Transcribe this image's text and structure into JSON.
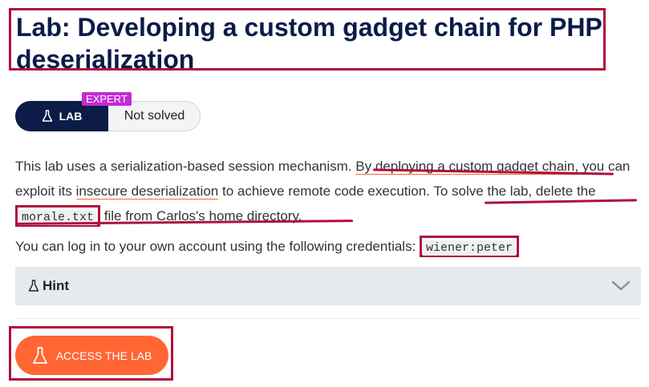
{
  "header": {
    "title": "Lab: Developing a custom gadget chain for PHP deserialization"
  },
  "badge": {
    "level": "EXPERT",
    "lab_label": "LAB",
    "status": "Not solved"
  },
  "description": {
    "p1_a": "This lab uses a serialization-based session mechanism. ",
    "p1_link1": "By deploying a custom gadget chain,",
    "p1_b": " you can exploit its ",
    "p1_link2": "insecure deserialization",
    "p1_c": " to achieve remote code execution. To solve the lab, delete the ",
    "p1_code": "morale.txt",
    "p1_d": " file from Carlos's home directory.",
    "p2_a": "You can log in to your own account using the following credentials: ",
    "p2_code": "wiener:peter"
  },
  "hint": {
    "label": "Hint"
  },
  "access": {
    "label": "ACCESS THE LAB"
  },
  "colors": {
    "navy": "#0a1c47",
    "orange": "#ff6633",
    "expert": "#c52bd5",
    "annotation": "#b0103a",
    "hint_bg": "#e6eaee"
  }
}
